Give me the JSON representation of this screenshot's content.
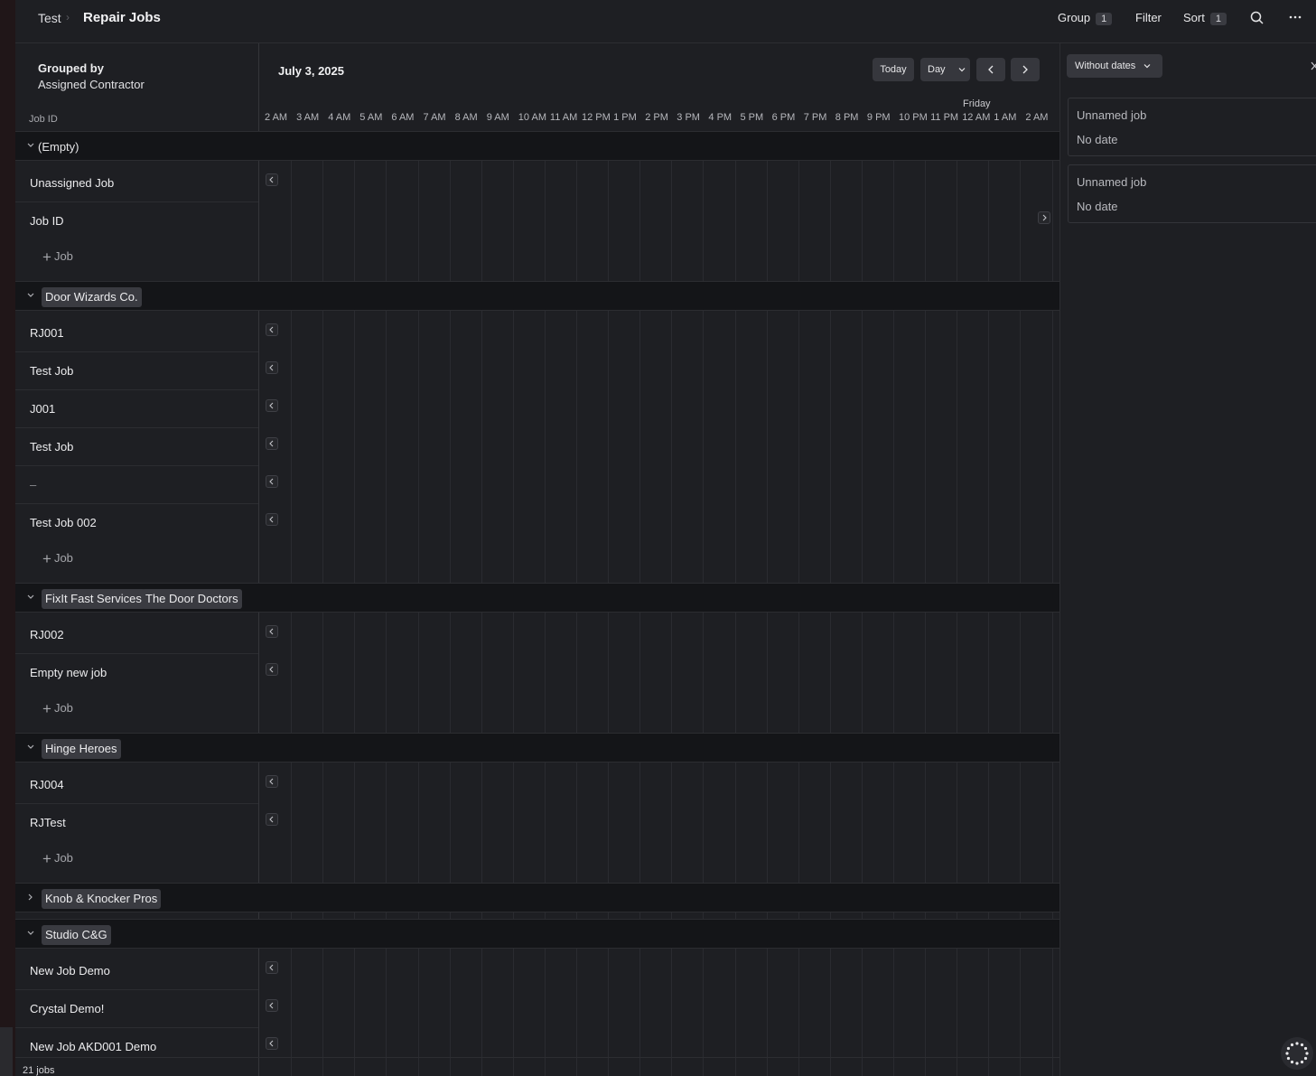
{
  "breadcrumb": {
    "workspace": "Test",
    "page": "Repair Jobs"
  },
  "toolbar": {
    "group_label": "Group",
    "group_count": "1",
    "filter_label": "Filter",
    "sort_label": "Sort",
    "sort_count": "1"
  },
  "left_header": {
    "grouped_by_title": "Grouped by",
    "grouped_by_value": "Assigned Contractor",
    "column_label": "Job ID"
  },
  "timeline": {
    "date_label": "July 3, 2025",
    "today_label": "Today",
    "view_label": "Day",
    "day_marker": "Friday",
    "hours": [
      "2 AM",
      "3 AM",
      "4 AM",
      "5 AM",
      "6 AM",
      "7 AM",
      "8 AM",
      "9 AM",
      "10 AM",
      "11 AM",
      "12 PM",
      "1 PM",
      "2 PM",
      "3 PM",
      "4 PM",
      "5 PM",
      "6 PM",
      "7 PM",
      "8 PM",
      "9 PM",
      "10 PM",
      "11 PM",
      "12 AM",
      "1 AM",
      "2 AM"
    ]
  },
  "side_panel": {
    "filter_label": "Without dates",
    "cards": [
      {
        "title": "Unnamed job",
        "date": "No date"
      },
      {
        "title": "Unnamed job",
        "date": "No date"
      }
    ]
  },
  "groups": {
    "empty": {
      "label": "(Empty)",
      "rows": [
        "Unassigned Job",
        "Job ID"
      ],
      "add_label": "Job"
    },
    "door_wizards": {
      "tag": "Door Wizards Co.",
      "rows": [
        "RJ001",
        "Test Job",
        "J001",
        "Test Job",
        "–",
        "Test Job 002"
      ],
      "add_label": "Job"
    },
    "fixit": {
      "tags": [
        "FixIt Fast Services",
        "The Door Doctors"
      ],
      "rows": [
        "RJ002",
        "Empty new job"
      ],
      "add_label": "Job"
    },
    "hinge": {
      "tag": "Hinge Heroes",
      "rows": [
        "RJ004",
        "RJTest"
      ],
      "add_label": "Job"
    },
    "knob": {
      "tag": "Knob & Knocker Pros"
    },
    "studio": {
      "tag": "Studio C&G",
      "rows": [
        "New Job Demo",
        "Crystal Demo!",
        "New Job AKD001 Demo"
      ]
    }
  },
  "footer": {
    "count_label": "21 jobs"
  }
}
